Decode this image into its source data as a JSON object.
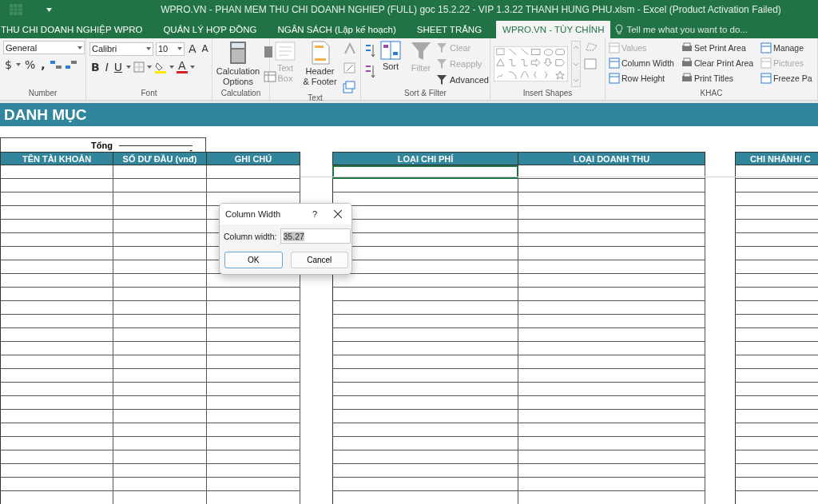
{
  "window": {
    "title": "WPRO.VN - PHAN MEM THU CHI DOANH NGHIEP (FULL) goc 15.2.22 - VIP 1.3.22 THANH HUNG PHU.xlsm - Excel (Product Activation Failed)"
  },
  "ribbon_tabs": [
    {
      "label": "THU CHI DOANH NGHIỆP WPRO",
      "selected": false
    },
    {
      "label": "QUẢN LÝ HỢP ĐỒNG",
      "selected": false
    },
    {
      "label": "NGÂN SÁCH (Lập kế hoạch)",
      "selected": false
    },
    {
      "label": "SHEET TRẮNG",
      "selected": false
    },
    {
      "label": "WPRO.VN - TÙY CHỈNH",
      "selected": true
    }
  ],
  "tell_me": {
    "placeholder": "Tell me what you want to do..."
  },
  "ribbon_groups": [
    {
      "kind": "number",
      "label": "Number",
      "format": "General",
      "symbols": [
        "$",
        "%",
        ","
      ]
    },
    {
      "kind": "font",
      "label": "Font",
      "font": "Calibri",
      "size": "10",
      "grow_shrink": [
        "A",
        "A"
      ],
      "styles": [
        "B",
        "I",
        "U"
      ],
      "font_color_letter": "A"
    },
    {
      "kind": "calculation",
      "label": "Calculation",
      "buttons": [
        {
          "label": "Calculation Options",
          "disabled": false
        }
      ]
    },
    {
      "kind": "text",
      "label": "Text",
      "buttons": [
        {
          "label": "Text Box",
          "disabled": true
        },
        {
          "label": "Header & Footer",
          "disabled": false
        }
      ]
    },
    {
      "kind": "sort",
      "label": "Sort & Filter",
      "buttons": [
        {
          "label": "Sort",
          "disabled": false
        },
        {
          "label": "Filter",
          "disabled": true
        }
      ],
      "small": [
        {
          "label": "Clear",
          "disabled": true
        },
        {
          "label": "Reapply",
          "disabled": true
        },
        {
          "label": "Advanced",
          "disabled": false
        }
      ]
    },
    {
      "kind": "shapes",
      "label": "Insert Shapes"
    },
    {
      "kind": "khac",
      "label": "KHAC",
      "small": [
        {
          "label": "Values",
          "disabled": true
        },
        {
          "label": "Column Width",
          "disabled": false
        },
        {
          "label": "Row Height",
          "disabled": false
        },
        {
          "label": "Set Print Area",
          "disabled": false
        },
        {
          "label": "Clear Print Area",
          "disabled": false
        },
        {
          "label": "Print Titles",
          "disabled": false
        },
        {
          "label": "Manage",
          "disabled": false
        },
        {
          "label": "Pictures",
          "disabled": true
        },
        {
          "label": "Freeze Pa",
          "disabled": false
        }
      ]
    }
  ],
  "sheet": {
    "title": "DANH MỤC",
    "total_label": "Tổng",
    "total_value": "-",
    "tables": [
      {
        "columns": [
          {
            "header": "TÊN TÀI KHOẢN",
            "active_cell": false
          },
          {
            "header": "SỐ DƯ ĐẦU (vnđ)",
            "active_cell": false
          },
          {
            "header": "GHI CHÚ",
            "active_cell": false
          }
        ]
      },
      {
        "columns": [
          {
            "header": "LOẠI CHI PHÍ",
            "active_cell": true
          },
          {
            "header": "LOẠI DOANH THU",
            "active_cell": false
          }
        ]
      },
      {
        "columns": [
          {
            "header": "CHI NHÁNH/ C",
            "active_cell": false
          }
        ]
      }
    ]
  },
  "dialog": {
    "title": "Column Width",
    "help": "?",
    "field_label": "Column width:",
    "field_value": "35.27",
    "value_selected": true,
    "buttons": [
      {
        "label": "OK",
        "default": true
      },
      {
        "label": "Cancel",
        "default": false
      }
    ]
  }
}
